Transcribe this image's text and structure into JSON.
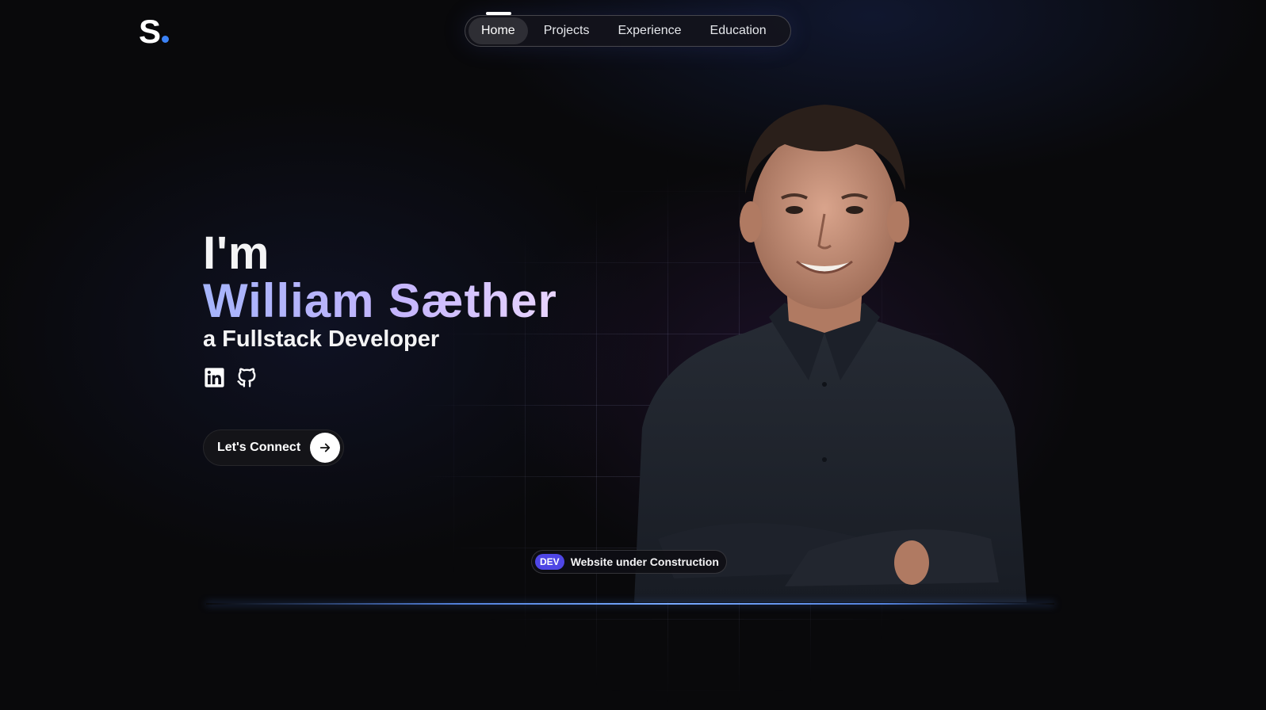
{
  "logo": {
    "letter": "S",
    "dot_color": "#3b82f6"
  },
  "nav": {
    "items": [
      {
        "label": "Home",
        "active": true
      },
      {
        "label": "Projects",
        "active": false
      },
      {
        "label": "Experience",
        "active": false
      },
      {
        "label": "Education",
        "active": false
      }
    ]
  },
  "hero": {
    "greeting": "I'm",
    "name": "William Sæther",
    "role": "a Fullstack Developer",
    "socials": [
      {
        "icon": "linkedin-icon"
      },
      {
        "icon": "github-icon"
      }
    ],
    "cta_label": "Let's Connect",
    "cta_icon": "arrow-right-icon"
  },
  "status_badge": {
    "tag": "DEV",
    "text": "Website under Construction"
  },
  "colors": {
    "background": "#09090b",
    "accent_blue": "#3b82f6",
    "badge_purple": "#4f46e5",
    "name_gradient_start": "#a5b4fc",
    "name_gradient_end": "#e9d5ff"
  }
}
